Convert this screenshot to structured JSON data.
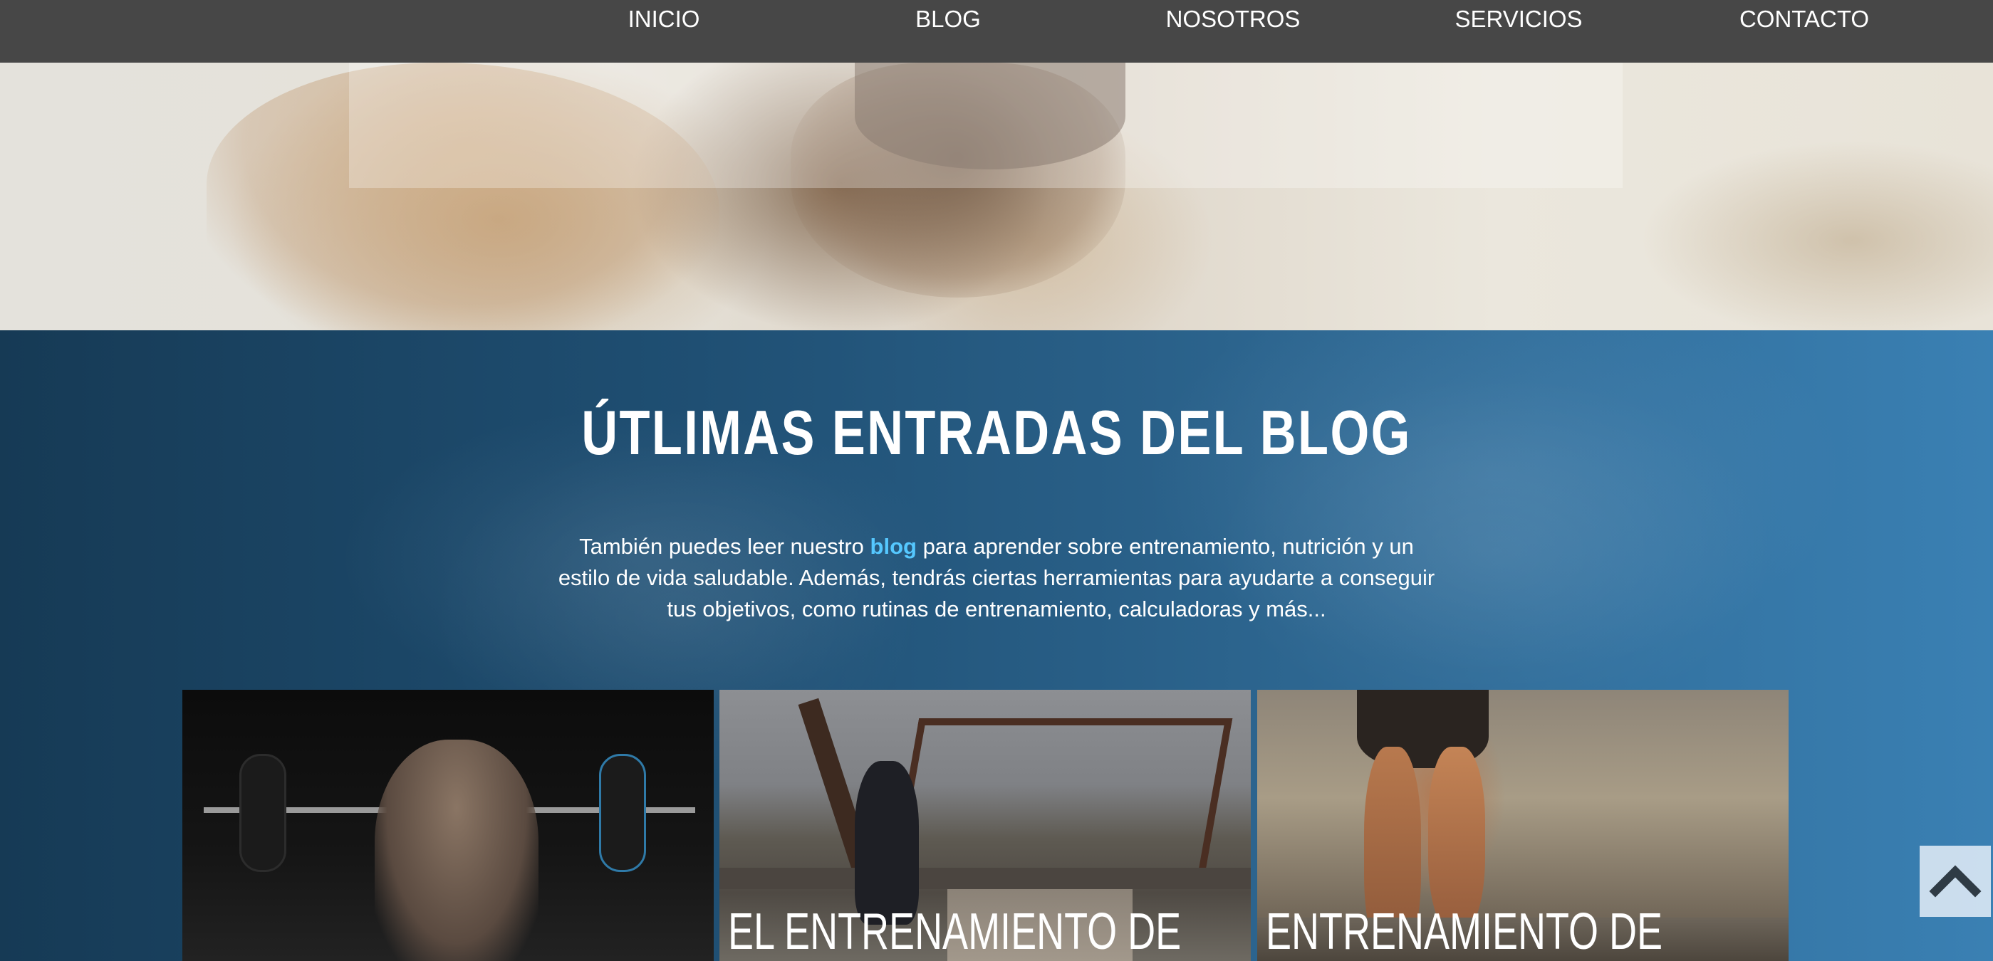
{
  "nav": {
    "items": [
      {
        "label": "INICIO"
      },
      {
        "label": "BLOG"
      },
      {
        "label": "NOSOTROS"
      },
      {
        "label": "SERVICIOS"
      },
      {
        "label": "CONTACTO"
      }
    ]
  },
  "blog": {
    "title": "ÚTLIMAS ENTRADAS DEL BLOG",
    "desc_before": "También puedes leer nuestro ",
    "desc_link": "blog",
    "desc_after": " para aprender sobre entrenamiento, nutrición y un estilo de vida saludable. Además, tendrás ciertas herramientas para ayudarte a conseguir tus objetivos, como rutinas de entrenamiento, calculadoras y más...",
    "cards": [
      {
        "title": ""
      },
      {
        "title": "EL ENTRENAMIENTO DE"
      },
      {
        "title": "ENTRENAMIENTO DE"
      }
    ]
  },
  "scroll_top": {
    "icon": "chevron-up-icon"
  },
  "colors": {
    "nav_bg": "#474747",
    "link": "#55c8ff",
    "section_start": "#163a55",
    "section_end": "#3a80b3"
  }
}
